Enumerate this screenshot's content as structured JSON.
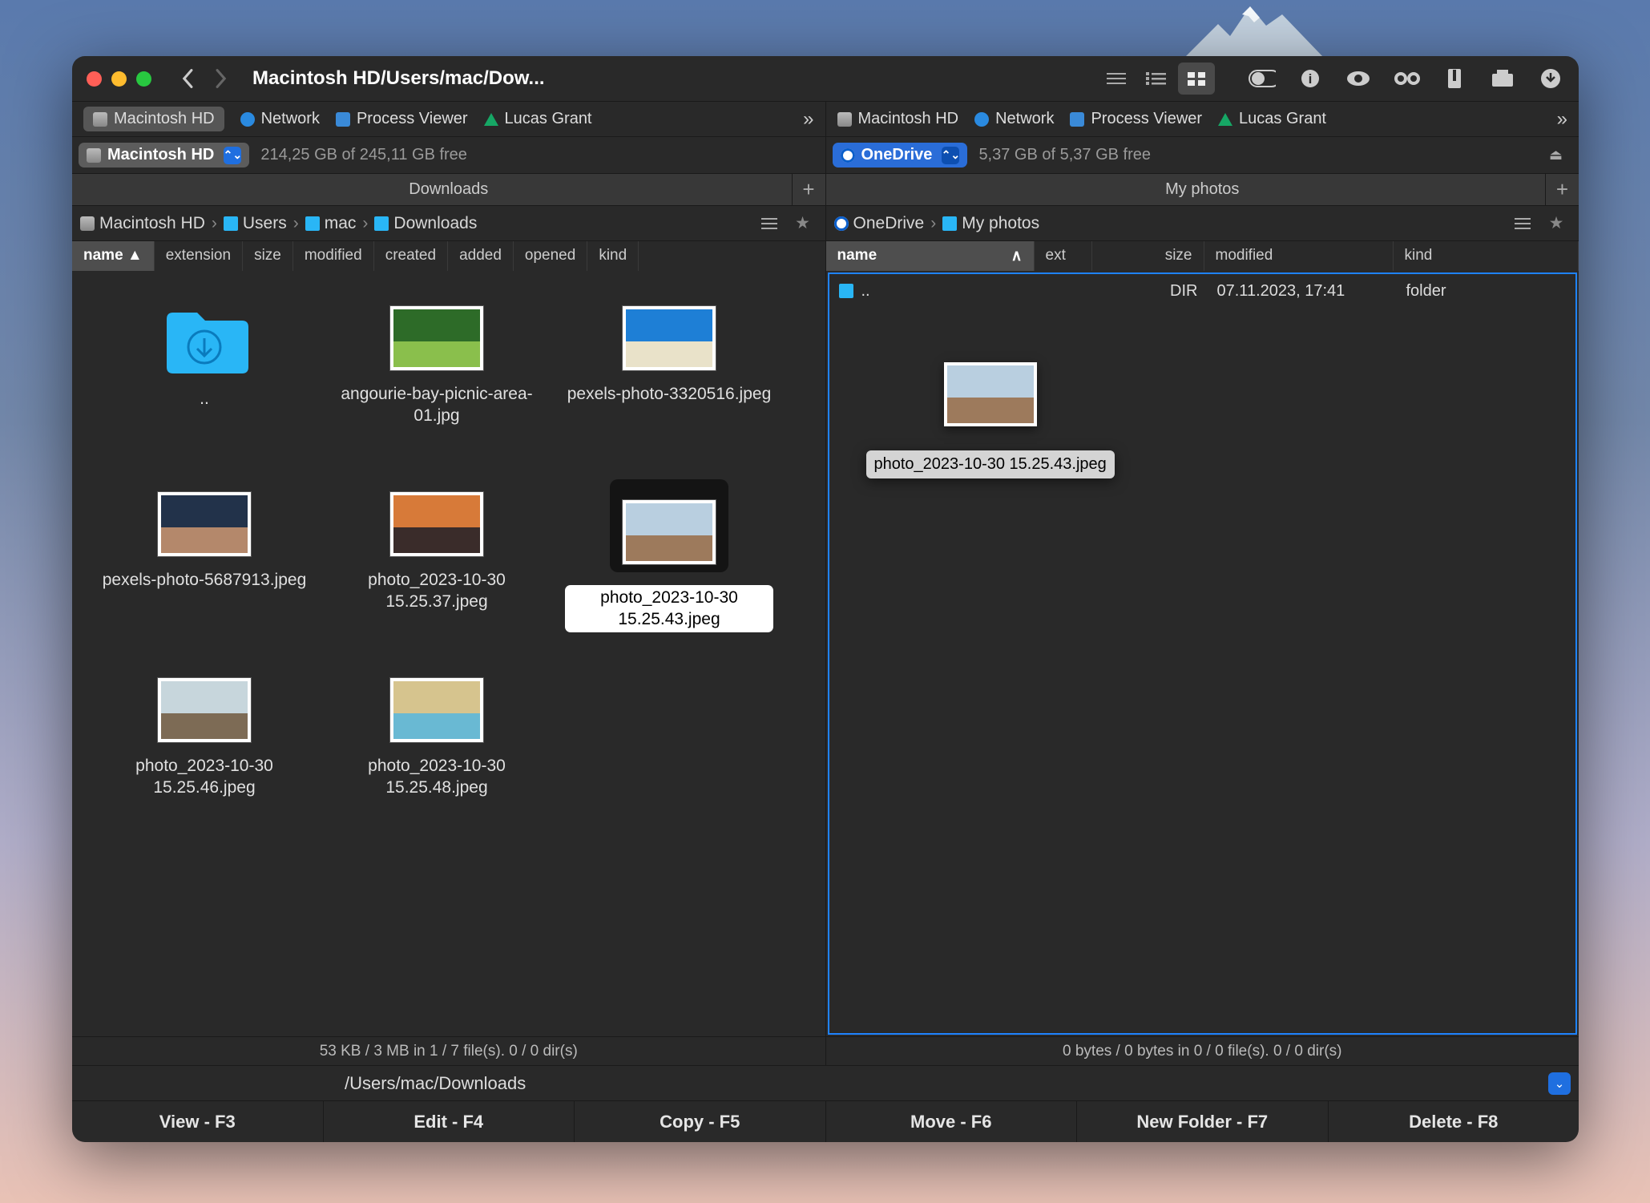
{
  "window": {
    "title": "Macintosh HD/Users/mac/Dow..."
  },
  "tabs_left": [
    {
      "icon": "hd",
      "label": "Macintosh HD",
      "active": true
    },
    {
      "icon": "net",
      "label": "Network"
    },
    {
      "icon": "mon",
      "label": "Process Viewer"
    },
    {
      "icon": "gd",
      "label": "Lucas Grant"
    }
  ],
  "tabs_right": [
    {
      "icon": "hd",
      "label": "Macintosh HD"
    },
    {
      "icon": "net",
      "label": "Network"
    },
    {
      "icon": "mon",
      "label": "Process Viewer"
    },
    {
      "icon": "gd",
      "label": "Lucas Grant"
    }
  ],
  "drives": {
    "left": {
      "name": "Macintosh HD",
      "free": "214,25 GB of 245,11 GB free"
    },
    "right": {
      "name": "OneDrive",
      "free": "5,37 GB of 5,37 GB free"
    }
  },
  "folder_tabs": {
    "left": "Downloads",
    "right": "My photos"
  },
  "breadcrumb": {
    "left": [
      {
        "icon": "hd",
        "label": "Macintosh HD"
      },
      {
        "icon": "folder",
        "label": "Users"
      },
      {
        "icon": "folder",
        "label": "mac"
      },
      {
        "icon": "folder",
        "label": "Downloads"
      }
    ],
    "right": [
      {
        "icon": "od",
        "label": "OneDrive"
      },
      {
        "icon": "folder",
        "label": "My photos"
      }
    ]
  },
  "columns_left": [
    "name ▲",
    "extension",
    "size",
    "modified",
    "created",
    "added",
    "opened",
    "kind"
  ],
  "columns_right": [
    "name",
    "ext",
    "size",
    "modified",
    "kind"
  ],
  "files_left": [
    {
      "type": "folder",
      "name": ".."
    },
    {
      "type": "image",
      "name": "angourie-bay-picnic-area-01.jpg",
      "colors": [
        "#2d6b28",
        "#8abf4c"
      ]
    },
    {
      "type": "image",
      "name": "pexels-photo-3320516.jpeg",
      "colors": [
        "#1e7fd6",
        "#e9e2c9"
      ]
    },
    {
      "type": "image",
      "name": "pexels-photo-5687913.jpeg",
      "colors": [
        "#22324a",
        "#b4886b"
      ]
    },
    {
      "type": "image",
      "name": "photo_2023-10-30 15.25.37.jpeg",
      "colors": [
        "#d77a39",
        "#3a2c2a"
      ]
    },
    {
      "type": "image",
      "name": "photo_2023-10-30 15.25.43.jpeg",
      "colors": [
        "#b9cfe0",
        "#9d7a5c"
      ],
      "selected": true
    },
    {
      "type": "image",
      "name": "photo_2023-10-30 15.25.46.jpeg",
      "colors": [
        "#c7d6dc",
        "#7d6b55"
      ]
    },
    {
      "type": "image",
      "name": "photo_2023-10-30 15.25.48.jpeg",
      "colors": [
        "#d6c48e",
        "#69b9d3"
      ]
    }
  ],
  "files_right": [
    {
      "name": "..",
      "ext": "",
      "size": "DIR",
      "modified": "07.11.2023, 17:41",
      "kind": "folder"
    }
  ],
  "drag_ghost": {
    "name": "photo_2023-10-30 15.25.43.jpeg",
    "colors": [
      "#b9cfe0",
      "#9d7a5c"
    ]
  },
  "status": {
    "left": "53 KB / 3 MB in 1 / 7 file(s). 0 / 0 dir(s)",
    "right": "0 bytes / 0 bytes in 0 / 0 file(s). 0 / 0 dir(s)"
  },
  "pathbar": "/Users/mac/Downloads",
  "fkeys": [
    "View - F3",
    "Edit - F4",
    "Copy - F5",
    "Move - F6",
    "New Folder - F7",
    "Delete - F8"
  ]
}
